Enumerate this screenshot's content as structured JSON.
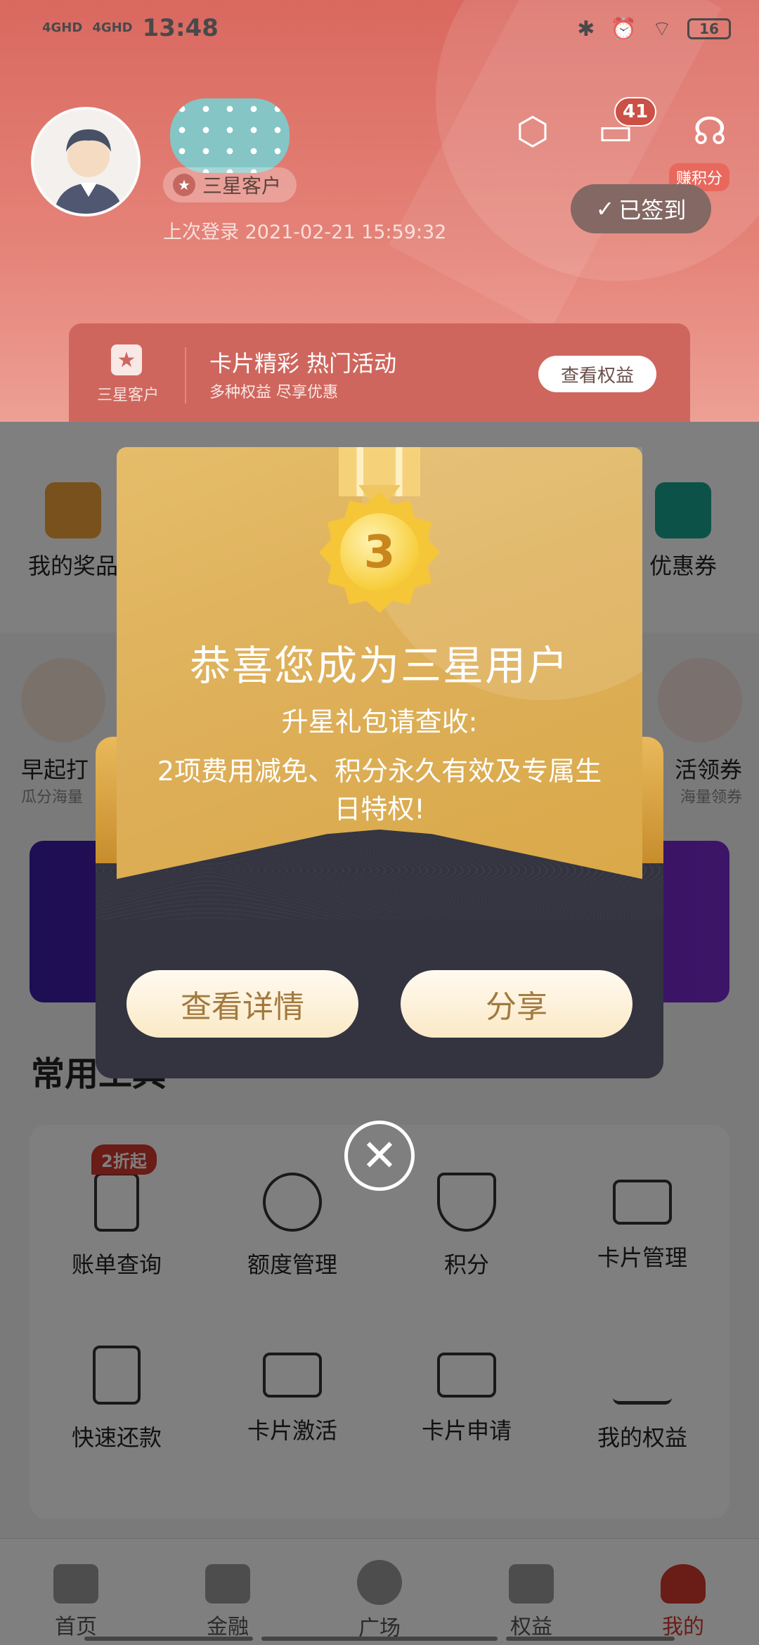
{
  "status_bar": {
    "network1": "4GHD",
    "network2": "4GHD",
    "time": "13:48",
    "battery": "16"
  },
  "profile": {
    "level_badge": "三星客户",
    "last_login": "上次登录 2021-02-21 15:59:32"
  },
  "header_actions": {
    "message_count": "41",
    "earn_points": "赚积分",
    "signed_in": "已签到"
  },
  "promo": {
    "level": "三星客户",
    "title": "卡片精彩 热门活动",
    "subtitle": "多种权益 尽享优惠",
    "button": "查看权益"
  },
  "quick_items": [
    {
      "label": "我的奖品"
    },
    {
      "label": "优惠券"
    }
  ],
  "activity_items": [
    {
      "label": "早起打",
      "sub": "瓜分海量"
    },
    {
      "label": "活领券",
      "sub": "海量领券"
    }
  ],
  "section": {
    "title": "常用工具"
  },
  "tools": {
    "badge": "2折起",
    "items": [
      "账单查询",
      "额度管理",
      "积分",
      "卡片管理",
      "快速还款",
      "卡片激活",
      "卡片申请",
      "我的权益"
    ]
  },
  "tabbar": [
    "首页",
    "金融",
    "广场",
    "权益",
    "我的"
  ],
  "modal": {
    "medal_number": "3",
    "title": "恭喜您成为三星用户",
    "subtitle": "升星礼包请查收:",
    "description": "2项费用减免、积分永久有效及专属生日特权!",
    "btn_details": "查看详情",
    "btn_share": "分享",
    "close": "✕"
  },
  "colors": {
    "brand_red": "#d4382c",
    "gold": "#deb05a",
    "modal_dark": "#33343f"
  }
}
